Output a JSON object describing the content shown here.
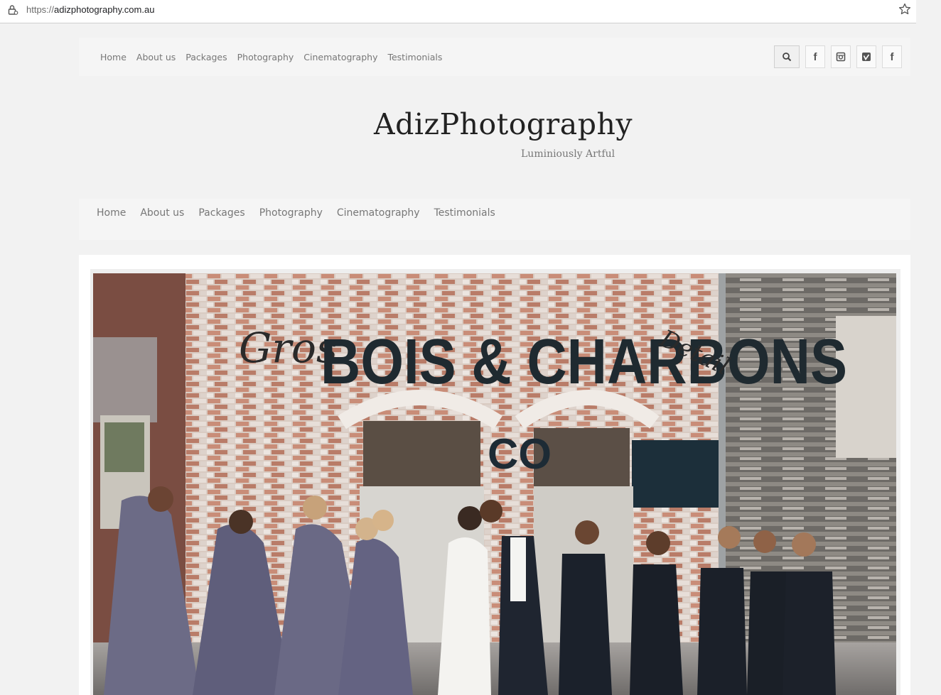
{
  "browser": {
    "url_scheme": "https://",
    "url_host": "adizphotography.com.au"
  },
  "top_nav": [
    "Home",
    "About us",
    "Packages",
    "Photography",
    "Cinematography",
    "Testimonials"
  ],
  "social": [
    {
      "icon": "search-icon"
    },
    {
      "icon": "facebook-icon"
    },
    {
      "icon": "instagram-icon"
    },
    {
      "icon": "vimeo-icon"
    },
    {
      "icon": "facebook-icon"
    }
  ],
  "site": {
    "title": "AdizPhotography",
    "tagline": "Luminiously Artful"
  },
  "main_nav": [
    "Home",
    "About us",
    "Packages",
    "Photography",
    "Cinematography",
    "Testimonials"
  ],
  "hero": {
    "sign_left": "Gros",
    "sign_main": "BOIS & CHARBONS",
    "sign_right": "Detail",
    "door_letters": "CO"
  },
  "colors": {
    "page_bg": "#f2f2f2",
    "nav_text": "#777777",
    "title_text": "#222222"
  }
}
